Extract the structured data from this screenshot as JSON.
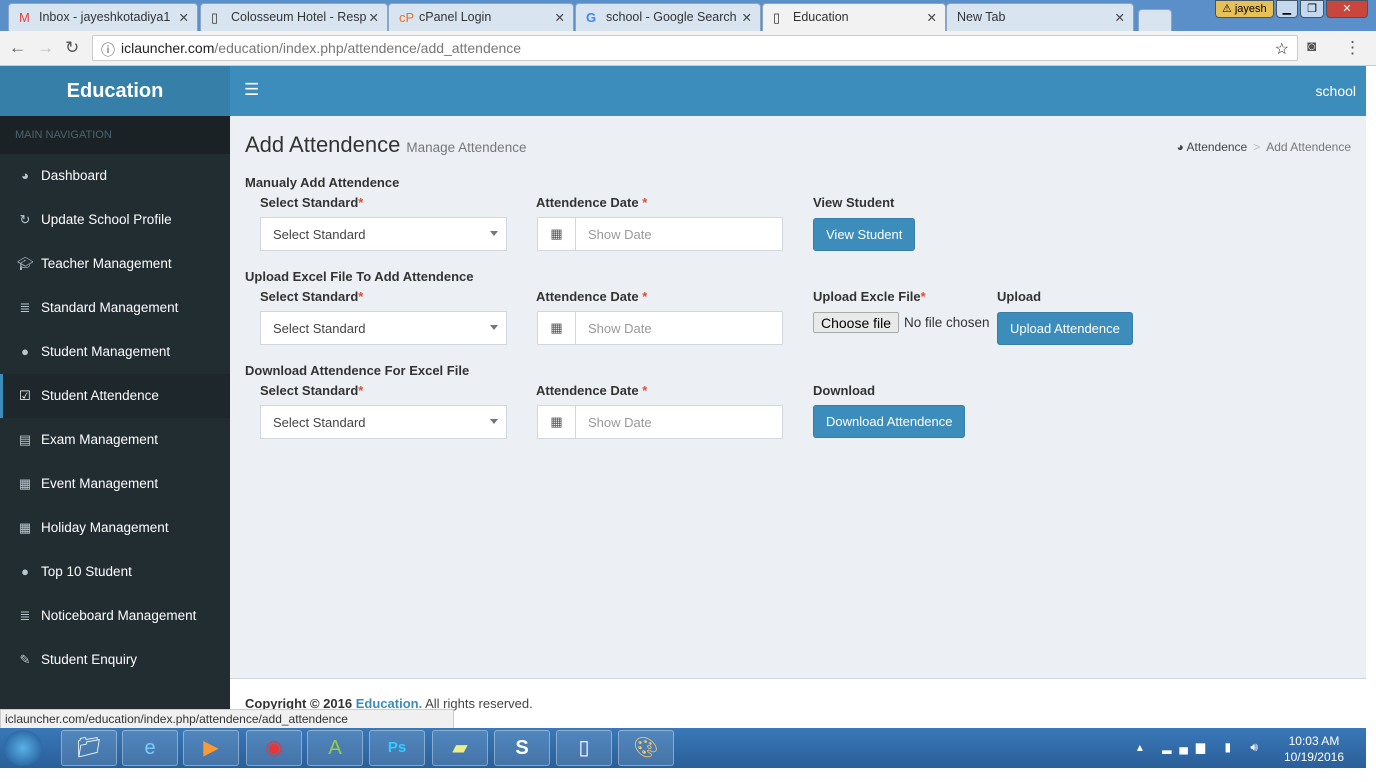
{
  "browser": {
    "tabs": [
      {
        "title": "Inbox - jayeshkotadiya1",
        "icon": "gmail-icon"
      },
      {
        "title": "Colosseum Hotel - Resp",
        "icon": "page-icon"
      },
      {
        "title": "cPanel Login",
        "icon": "cpanel-icon"
      },
      {
        "title": "school - Google Search",
        "icon": "google-icon"
      },
      {
        "title": "Education",
        "icon": "page-icon",
        "active": true
      },
      {
        "title": "New Tab",
        "icon": ""
      }
    ],
    "user": "jayesh",
    "url_host": "iclauncher.com",
    "url_path": "/education/index.php/attendence/add_attendence",
    "status_url": "iclauncher.com/education/index.php/attendence/add_attendence"
  },
  "app": {
    "brand": "Education",
    "user": "school"
  },
  "sidebar": {
    "header": "MAIN NAVIGATION",
    "items": [
      {
        "label": "Dashboard",
        "icon": "dashboard-icon"
      },
      {
        "label": "Update School Profile",
        "icon": "refresh-icon"
      },
      {
        "label": "Teacher Management",
        "icon": "graduation-cap-icon"
      },
      {
        "label": "Standard Management",
        "icon": "list-icon"
      },
      {
        "label": "Student Management",
        "icon": "user-icon"
      },
      {
        "label": "Student Attendence",
        "icon": "calendar-check-icon",
        "active": true
      },
      {
        "label": "Exam Management",
        "icon": "briefcase-icon"
      },
      {
        "label": "Event Management",
        "icon": "calendar-icon"
      },
      {
        "label": "Holiday Management",
        "icon": "calendar-icon"
      },
      {
        "label": "Top 10 Student",
        "icon": "user-icon"
      },
      {
        "label": "Noticeboard Management",
        "icon": "list-icon"
      },
      {
        "label": "Student Enquiry",
        "icon": "edit-icon"
      }
    ]
  },
  "page": {
    "title": "Add Attendence",
    "subtitle": "Manage Attendence",
    "breadcrumb": [
      "Attendence",
      "Add Attendence"
    ]
  },
  "sections": [
    {
      "title": "Manualy Add Attendence",
      "std_label": "Select Standard",
      "std_value": "Select Standard",
      "date_label": "Attendence Date",
      "date_placeholder": "Show Date",
      "action_label": "View Student",
      "button": "View Student"
    },
    {
      "title": "Upload Excel File To Add Attendence",
      "std_label": "Select Standard",
      "std_value": "Select Standard",
      "date_label": "Attendence Date",
      "date_placeholder": "Show Date",
      "file_label": "Upload Excle File",
      "file_button": "Choose file",
      "file_status": "No file chosen",
      "action_label": "Upload",
      "button": "Upload Attendence"
    },
    {
      "title": "Download Attendence For Excel File",
      "std_label": "Select Standard",
      "std_value": "Select Standard",
      "date_label": "Attendence Date",
      "date_placeholder": "Show Date",
      "action_label": "Download",
      "button": "Download Attendence"
    }
  ],
  "footer": {
    "prefix": "Copyright © 2016",
    "link": "Education.",
    "suffix": "All rights reserved."
  },
  "taskbar": {
    "time": "10:03 AM",
    "date": "10/19/2016"
  }
}
